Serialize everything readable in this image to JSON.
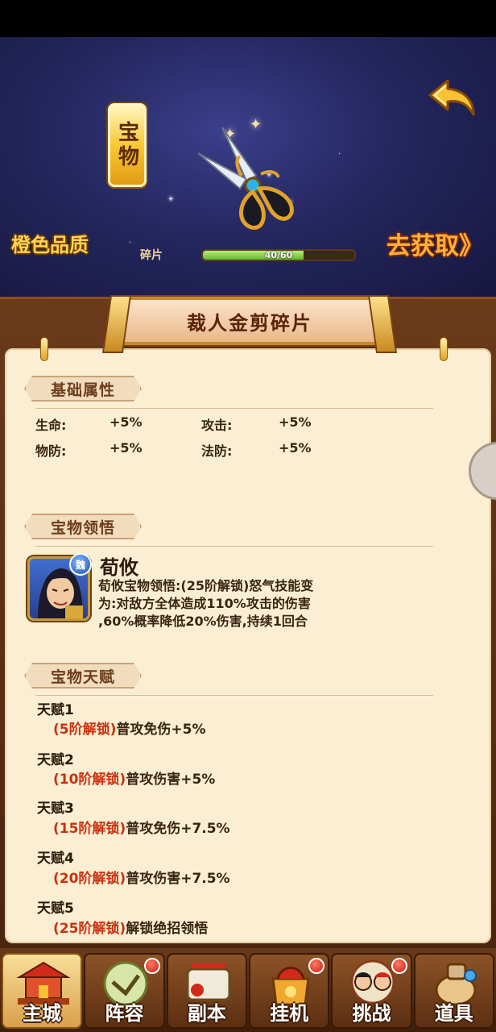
{
  "item": {
    "type_tag": "宝物",
    "quality": "橙色品质",
    "obtain_link": "去获取》",
    "fragment_label": "碎片",
    "progress_text": "40/60",
    "progress_fraction": 0.6667,
    "title": "裁人金剪碎片"
  },
  "sections": {
    "basic": "基础属性",
    "insight": "宝物领悟",
    "talent": "宝物天赋"
  },
  "attributes": [
    {
      "label": "生命:",
      "value": "+5%"
    },
    {
      "label": "攻击:",
      "value": "+5%"
    },
    {
      "label": "物防:",
      "value": "+5%"
    },
    {
      "label": "法防:",
      "value": "+5%"
    }
  ],
  "insight": {
    "badge": "魏",
    "hero_name": "荀攸",
    "lines": [
      "荀攸宝物领悟:(25阶解锁)怒气技能变",
      "为:对敌方全体造成110%攻击的伤害",
      ",60%概率降低20%伤害,持续1回合"
    ]
  },
  "talents": [
    {
      "title": "天赋1",
      "lock": "(5阶解锁)",
      "effect": "普攻免伤+5%"
    },
    {
      "title": "天赋2",
      "lock": "(10阶解锁)",
      "effect": "普攻伤害+5%"
    },
    {
      "title": "天赋3",
      "lock": "(15阶解锁)",
      "effect": "普攻免伤+7.5%"
    },
    {
      "title": "天赋4",
      "lock": "(20阶解锁)",
      "effect": "普攻伤害+7.5%"
    },
    {
      "title": "天赋5",
      "lock": "(25阶解锁)",
      "effect": "解锁绝招领悟"
    }
  ],
  "nav": [
    {
      "label": "主城",
      "icon": "palace-icon",
      "active": true
    },
    {
      "label": "阵容",
      "icon": "formation-fan-icon",
      "badge": true
    },
    {
      "label": "副本",
      "icon": "dungeon-scroll-icon"
    },
    {
      "label": "挂机",
      "icon": "treasure-bag-icon",
      "badge": true
    },
    {
      "label": "挑战",
      "icon": "challenge-heroes-icon",
      "badge": true
    },
    {
      "label": "道具",
      "icon": "item-bag-icon"
    }
  ],
  "colors": {
    "lock_text": "#c8320f",
    "progress_fill": "#62b82c",
    "paper": "#fbeed3",
    "frame": "#6b3a1b"
  }
}
